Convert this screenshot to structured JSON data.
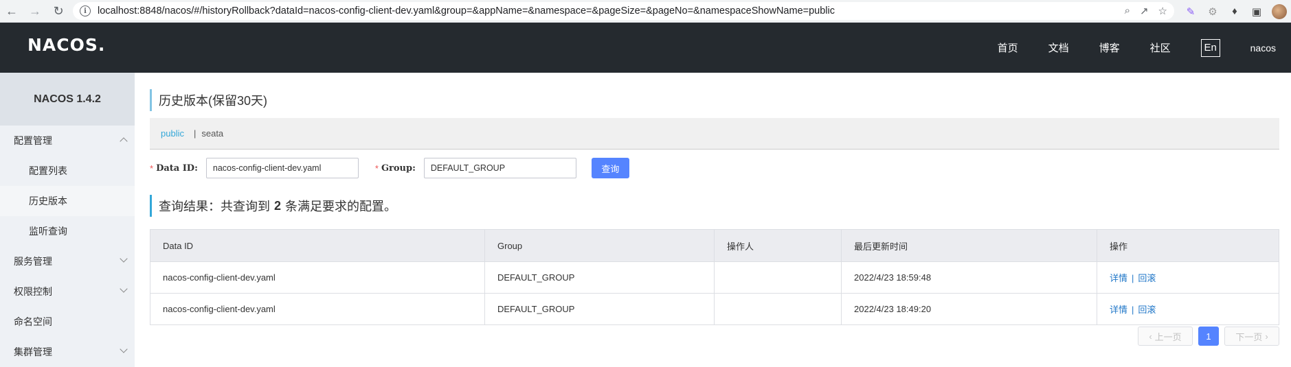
{
  "browser": {
    "url": "localhost:8848/nacos/#/historyRollback?dataId=nacos-config-client-dev.yaml&group=&appName=&namespace=&pageSize=&pageNo=&namespaceShowName=public"
  },
  "header": {
    "logo": "NACOS.",
    "links": [
      "首页",
      "文档",
      "博客",
      "社区"
    ],
    "lang": "En",
    "user": "nacos"
  },
  "sidebar": {
    "version": "NACOS 1.4.2",
    "items": [
      {
        "label": "配置管理",
        "type": "group",
        "expanded": true
      },
      {
        "label": "配置列表",
        "type": "sub"
      },
      {
        "label": "历史版本",
        "type": "sub",
        "active": true
      },
      {
        "label": "监听查询",
        "type": "sub"
      },
      {
        "label": "服务管理",
        "type": "group",
        "expanded": false
      },
      {
        "label": "权限控制",
        "type": "group",
        "expanded": false
      },
      {
        "label": "命名空间",
        "type": "item"
      },
      {
        "label": "集群管理",
        "type": "group",
        "expanded": false
      }
    ]
  },
  "main": {
    "title": "历史版本(保留30天)",
    "namespaces": {
      "active": "public",
      "separator": "|",
      "others": [
        "seata"
      ]
    },
    "form": {
      "required_mark": "*",
      "dataid_label": "Data ID:",
      "dataid_value": "nacos-config-client-dev.yaml",
      "group_label": "Group:",
      "group_value": "DEFAULT_GROUP",
      "query_button": "查询"
    },
    "result": {
      "prefix": "查询结果：共查询到",
      "count": "2",
      "suffix": "条满足要求的配置。"
    },
    "table": {
      "columns": [
        "Data ID",
        "Group",
        "操作人",
        "最后更新时间",
        "操作"
      ],
      "rows": [
        {
          "data_id": "nacos-config-client-dev.yaml",
          "group": "DEFAULT_GROUP",
          "operator": "",
          "updated": "2022/4/23 18:59:48",
          "detail": "详情",
          "rollback": "回滚"
        },
        {
          "data_id": "nacos-config-client-dev.yaml",
          "group": "DEFAULT_GROUP",
          "operator": "",
          "updated": "2022/4/23 18:49:20",
          "detail": "详情",
          "rollback": "回滚"
        }
      ],
      "action_sep": "|"
    },
    "pager": {
      "prev": "上一页",
      "current": "1",
      "next": "下一页"
    }
  },
  "colors": {
    "header_bg": "#252a2f",
    "primary": "#5584ff",
    "link": "#2077c8",
    "accent": "#33a7d8"
  }
}
